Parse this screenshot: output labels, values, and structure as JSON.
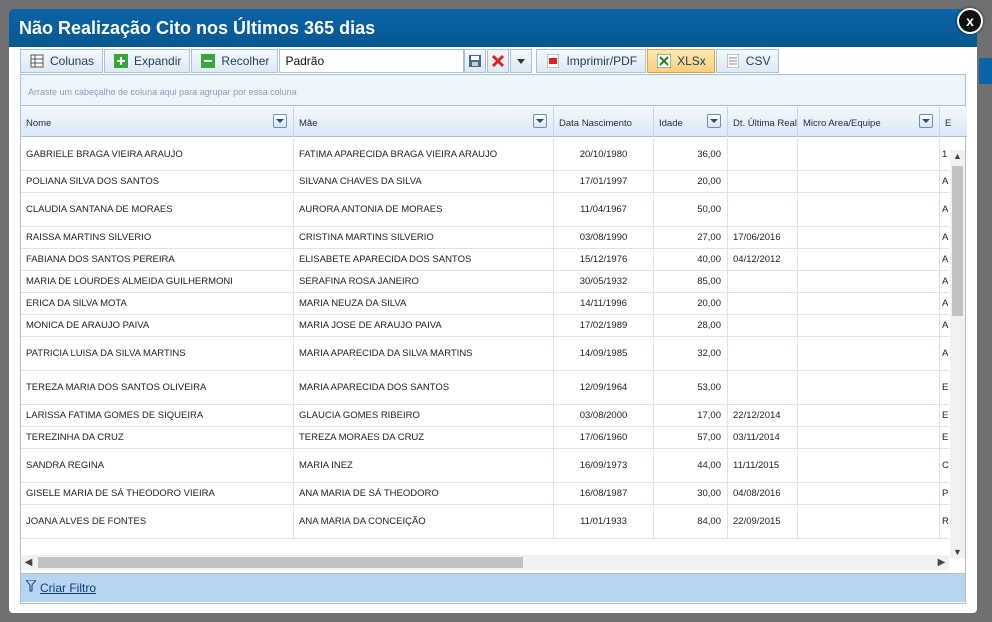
{
  "dialog": {
    "title": "Não Realização Cito nos Últimos 365 dias",
    "close_label": "x"
  },
  "toolbar": {
    "colunas": "Colunas",
    "expandir": "Expandir",
    "recolher": "Recolher",
    "layout_value": "Padrão",
    "imprimir": "Imprimir/PDF",
    "xlsx": "XLSx",
    "csv": "CSV"
  },
  "grid": {
    "group_hint": "Arraste um cabeçalho de coluna aqui para agrupar por essa coluna",
    "columns": [
      "Nome",
      "Mãe",
      "Data Nascimento",
      "Idade",
      "Dt. Última Real",
      "Micro Area/Equipe",
      "E"
    ],
    "rows": [
      {
        "nome": "GABRIELE BRAGA VIEIRA ARAUJO",
        "mae": "FATIMA APARECIDA BRAGA VIEIRA ARAUJO",
        "nasc": "20/10/1980",
        "idade": "36,00",
        "ultima": "",
        "micro": "",
        "e": "1"
      },
      {
        "nome": "POLIANA SILVA DOS SANTOS",
        "mae": "SILVANA CHAVES DA SILVA",
        "nasc": "17/01/1997",
        "idade": "20,00",
        "ultima": "",
        "micro": "",
        "e": "A"
      },
      {
        "nome": "CLAUDIA SANTANA DE MORAES",
        "mae": "AURORA ANTONIA DE MORAES",
        "nasc": "11/04/1967",
        "idade": "50,00",
        "ultima": "",
        "micro": "",
        "e": "A"
      },
      {
        "nome": "RAISSA MARTINS SILVERIO",
        "mae": "CRISTINA MARTINS SILVERIO",
        "nasc": "03/08/1990",
        "idade": "27,00",
        "ultima": "17/06/2016",
        "micro": "",
        "e": "A"
      },
      {
        "nome": "FABIANA DOS SANTOS PEREIRA",
        "mae": "ELISABETE APARECIDA DOS SANTOS",
        "nasc": "15/12/1976",
        "idade": "40,00",
        "ultima": "04/12/2012",
        "micro": "",
        "e": "A"
      },
      {
        "nome": "MARIA DE LOURDES ALMEIDA GUILHERMONI",
        "mae": "SERAFINA ROSA JANEIRO",
        "nasc": "30/05/1932",
        "idade": "85,00",
        "ultima": "",
        "micro": "",
        "e": "A"
      },
      {
        "nome": "ERICA DA SILVA MOTA",
        "mae": "MARIA NEUZA DA SILVA",
        "nasc": "14/11/1996",
        "idade": "20,00",
        "ultima": "",
        "micro": "",
        "e": "A"
      },
      {
        "nome": "MONICA DE ARAUJO PAIVA",
        "mae": "MARIA JOSE DE ARAUJO PAIVA",
        "nasc": "17/02/1989",
        "idade": "28,00",
        "ultima": "",
        "micro": "",
        "e": "A"
      },
      {
        "nome": "PATRICIA LUISA DA SILVA MARTINS",
        "mae": "MARIA APARECIDA DA SILVA MARTINS",
        "nasc": "14/09/1985",
        "idade": "32,00",
        "ultima": "",
        "micro": "",
        "e": "A"
      },
      {
        "nome": "TEREZA MARIA DOS SANTOS OLIVEIRA",
        "mae": "MARIA APARECIDA DOS SANTOS",
        "nasc": "12/09/1964",
        "idade": "53,00",
        "ultima": "",
        "micro": "",
        "e": "E"
      },
      {
        "nome": "LARISSA FATIMA GOMES DE SIQUEIRA",
        "mae": "GLAUCIA GOMES RIBEIRO",
        "nasc": "03/08/2000",
        "idade": "17,00",
        "ultima": "22/12/2014",
        "micro": "",
        "e": "E"
      },
      {
        "nome": "TEREZINHA DA CRUZ",
        "mae": "TEREZA MORAES DA CRUZ",
        "nasc": "17/06/1960",
        "idade": "57,00",
        "ultima": "03/11/2014",
        "micro": "",
        "e": "E"
      },
      {
        "nome": "SANDRA REGINA",
        "mae": "MARIA INEZ",
        "nasc": "16/09/1973",
        "idade": "44,00",
        "ultima": "11/11/2015",
        "micro": "",
        "e": "C"
      },
      {
        "nome": "GISELE MARIA DE SÁ THEODORO VIEIRA",
        "mae": "ANA MARIA DE SÁ THEODORO",
        "nasc": "16/08/1987",
        "idade": "30,00",
        "ultima": "04/08/2016",
        "micro": "",
        "e": "P"
      },
      {
        "nome": "JOANA ALVES DE FONTES",
        "mae": "ANA MARIA DA CONCEIÇÃO",
        "nasc": "11/01/1933",
        "idade": "84,00",
        "ultima": "22/09/2015",
        "micro": "",
        "e": "R"
      }
    ]
  },
  "footer": {
    "filter_link": "Criar Filtro"
  },
  "colors": {
    "title_bg": "#0a64a8",
    "header_bg": "#dbe8f6",
    "footer_bg": "#b9d4f0",
    "active_btn": "#fbcf7d"
  }
}
